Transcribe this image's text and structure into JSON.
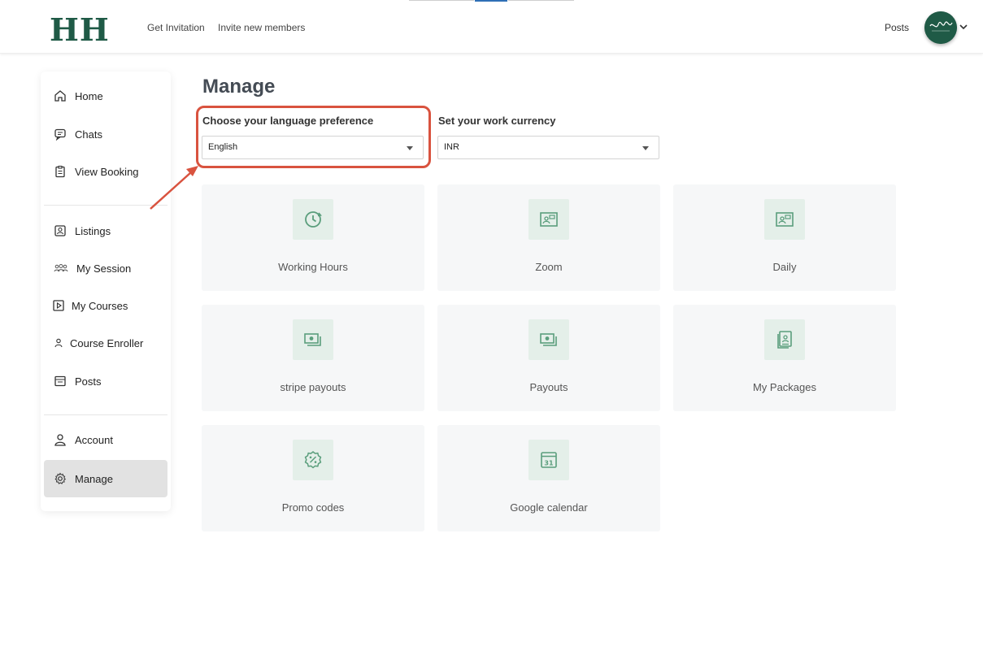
{
  "header": {
    "logo": "HH",
    "nav": [
      "Get Invitation",
      "Invite new members"
    ],
    "right_link": "Posts"
  },
  "sidebar": {
    "items": [
      {
        "label": "Home",
        "icon": "home-icon"
      },
      {
        "label": "Chats",
        "icon": "chat-icon"
      },
      {
        "label": "View Booking",
        "icon": "clipboard-icon"
      },
      {
        "label": "Listings",
        "icon": "listing-icon"
      },
      {
        "label": "My Session",
        "icon": "group-icon"
      },
      {
        "label": "My Courses",
        "icon": "play-icon"
      },
      {
        "label": "Course Enroller",
        "icon": "user-icon"
      },
      {
        "label": "Posts",
        "icon": "posts-icon"
      },
      {
        "label": "Account",
        "icon": "account-icon"
      },
      {
        "label": "Manage",
        "icon": "gear-icon"
      }
    ],
    "active": "Manage"
  },
  "main": {
    "title": "Manage",
    "language": {
      "label": "Choose your language preference",
      "value": "English"
    },
    "currency": {
      "label": "Set your work currency",
      "value": "INR"
    },
    "cards": [
      {
        "label": "Working Hours",
        "icon": "clock-icon"
      },
      {
        "label": "Zoom",
        "icon": "video-icon"
      },
      {
        "label": "Daily",
        "icon": "video-icon"
      },
      {
        "label": "stripe payouts",
        "icon": "money-icon"
      },
      {
        "label": "Payouts",
        "icon": "money-icon"
      },
      {
        "label": "My Packages",
        "icon": "package-icon"
      },
      {
        "label": "Promo codes",
        "icon": "discount-icon"
      },
      {
        "label": "Google calendar",
        "icon": "calendar-icon"
      }
    ]
  },
  "colors": {
    "brand": "#1f5a46",
    "icon_green": "#5a9e7c",
    "highlight": "#d9533f"
  }
}
